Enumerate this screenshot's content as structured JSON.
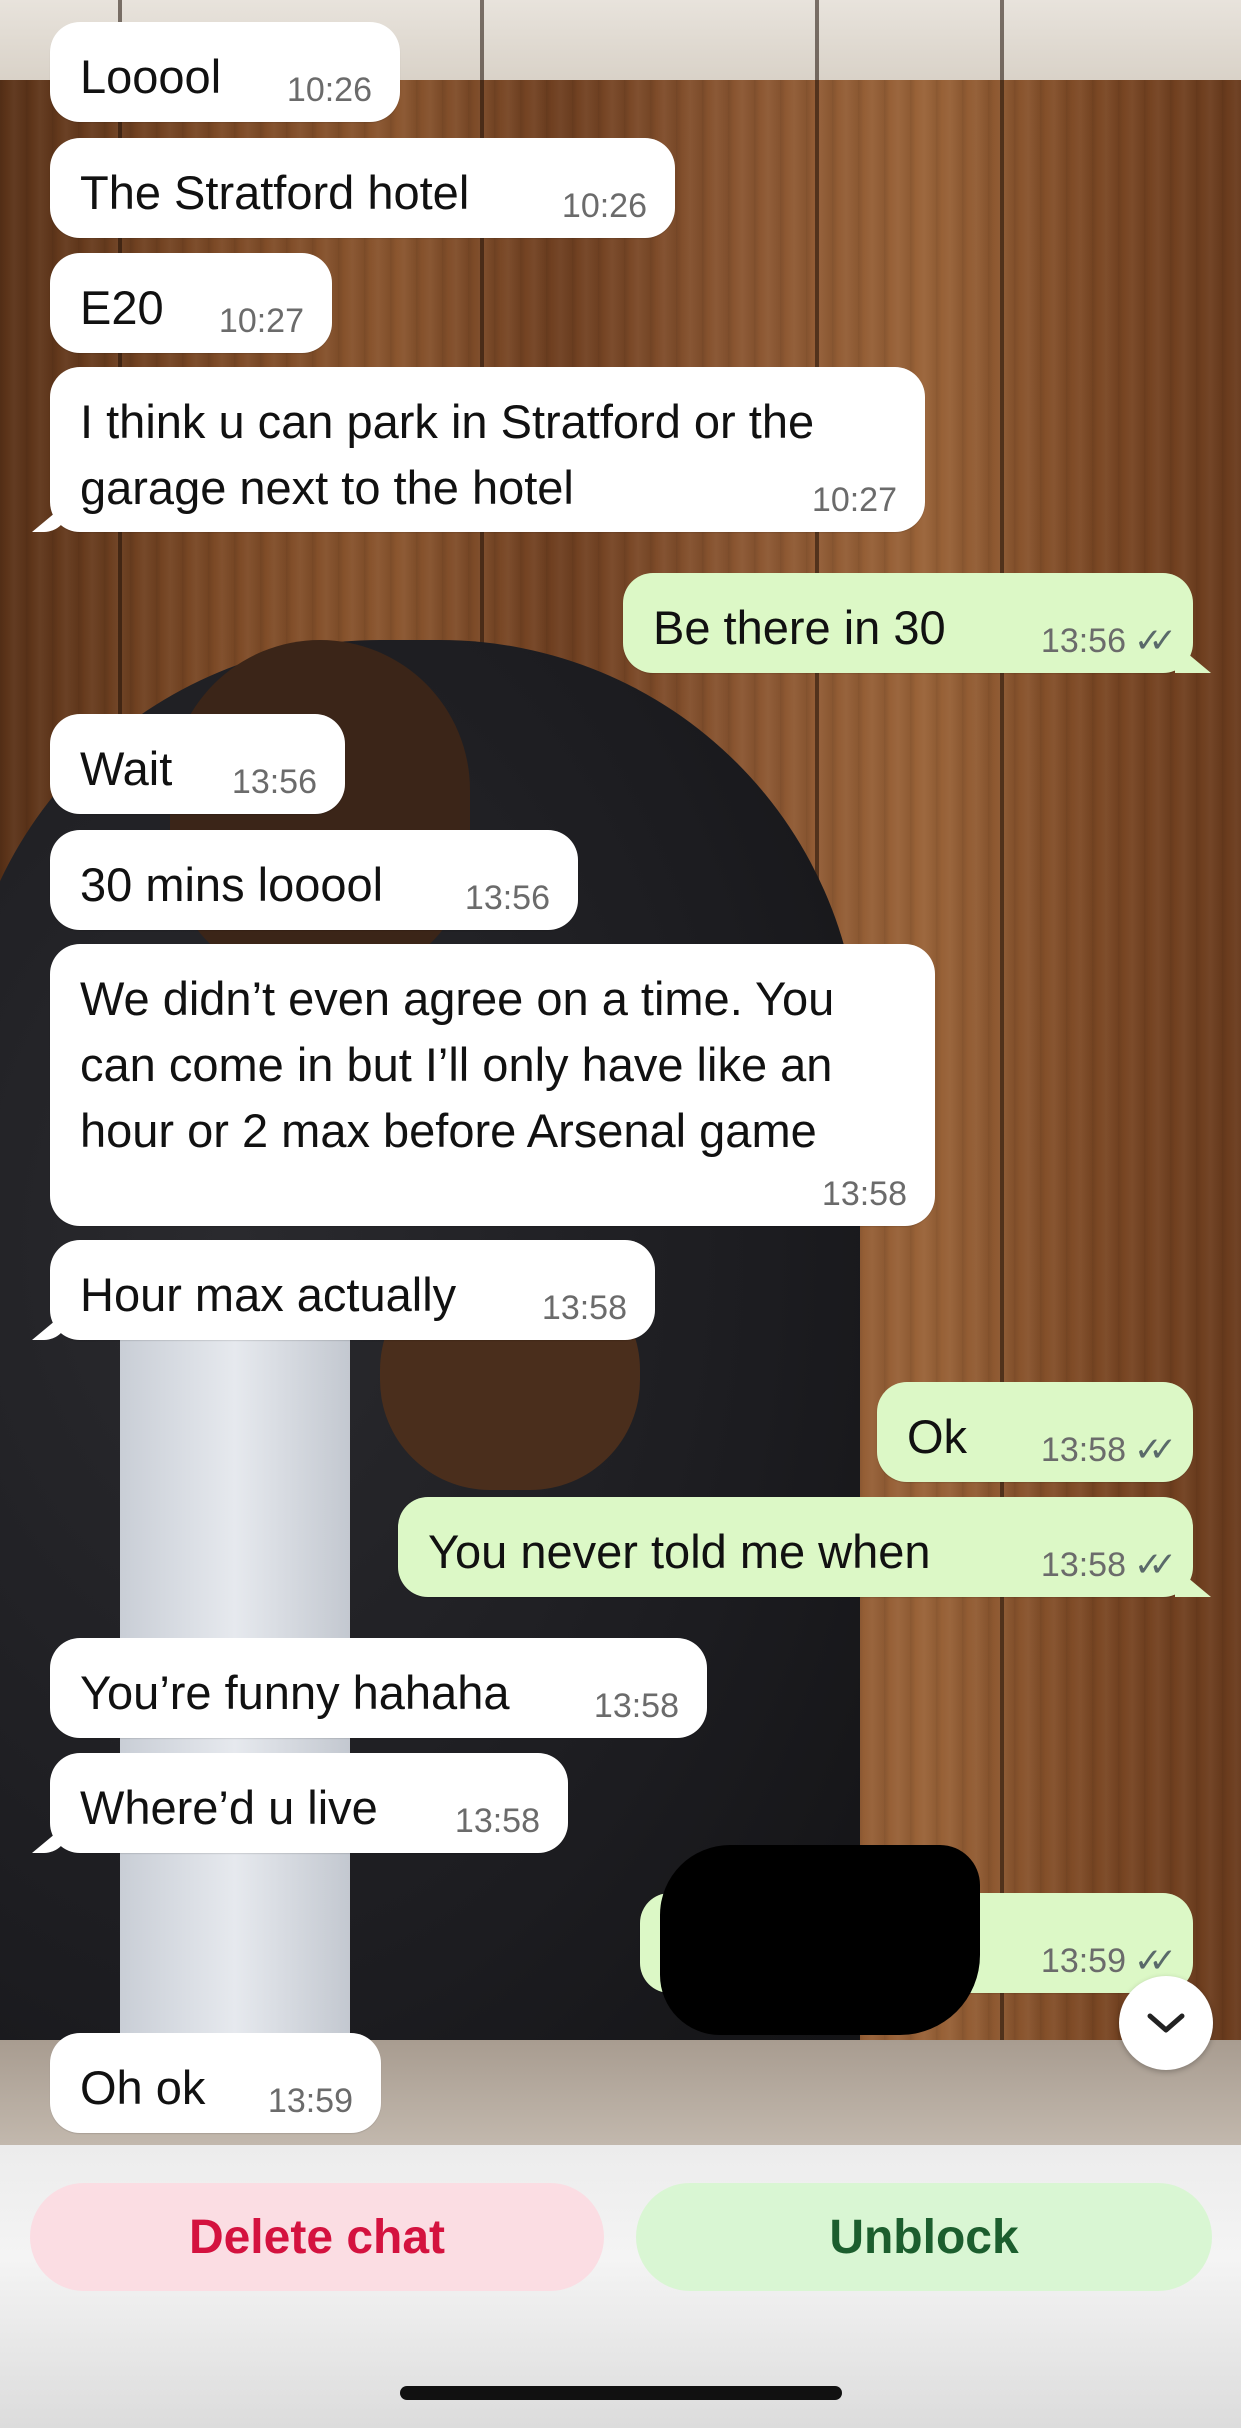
{
  "messages": [
    {
      "dir": "in",
      "text": "Looool",
      "time": "10:26"
    },
    {
      "dir": "in",
      "text": "The Stratford hotel",
      "time": "10:26"
    },
    {
      "dir": "in",
      "text": "E20",
      "time": "10:27"
    },
    {
      "dir": "in",
      "text": "I think u can park in Stratford or the garage next to the hotel",
      "time": "10:27"
    },
    {
      "dir": "out",
      "text": "Be there in 30",
      "time": "13:56"
    },
    {
      "dir": "in",
      "text": "Wait",
      "time": "13:56"
    },
    {
      "dir": "in",
      "text": "30 mins looool",
      "time": "13:56"
    },
    {
      "dir": "in",
      "text": "We didn’t even agree on a time. You can come in but I’ll only have like an hour or 2 max before Arsenal game",
      "time": "13:58"
    },
    {
      "dir": "in",
      "text": "Hour max actually",
      "time": "13:58"
    },
    {
      "dir": "out",
      "text": "Ok",
      "time": "13:58"
    },
    {
      "dir": "out",
      "text": "You never told me when",
      "time": "13:58"
    },
    {
      "dir": "in",
      "text": "You’re funny hahaha",
      "time": "13:58"
    },
    {
      "dir": "in",
      "text": "Where’d u live",
      "time": "13:58"
    },
    {
      "dir": "out",
      "text": "",
      "time": "13:59"
    },
    {
      "dir": "in",
      "text": "Oh ok",
      "time": "13:59"
    }
  ],
  "read_ticks": "✓✓",
  "actions": {
    "delete_label": "Delete chat",
    "unblock_label": "Unblock"
  },
  "icons": {
    "scroll_down": "chevron-down-icon",
    "read_receipt": "double-check-icon"
  },
  "colors": {
    "incoming_bubble": "#ffffff",
    "outgoing_bubble": "#dcf8c6",
    "delete_text": "#d4123f",
    "unblock_text": "#1c5e2e"
  }
}
